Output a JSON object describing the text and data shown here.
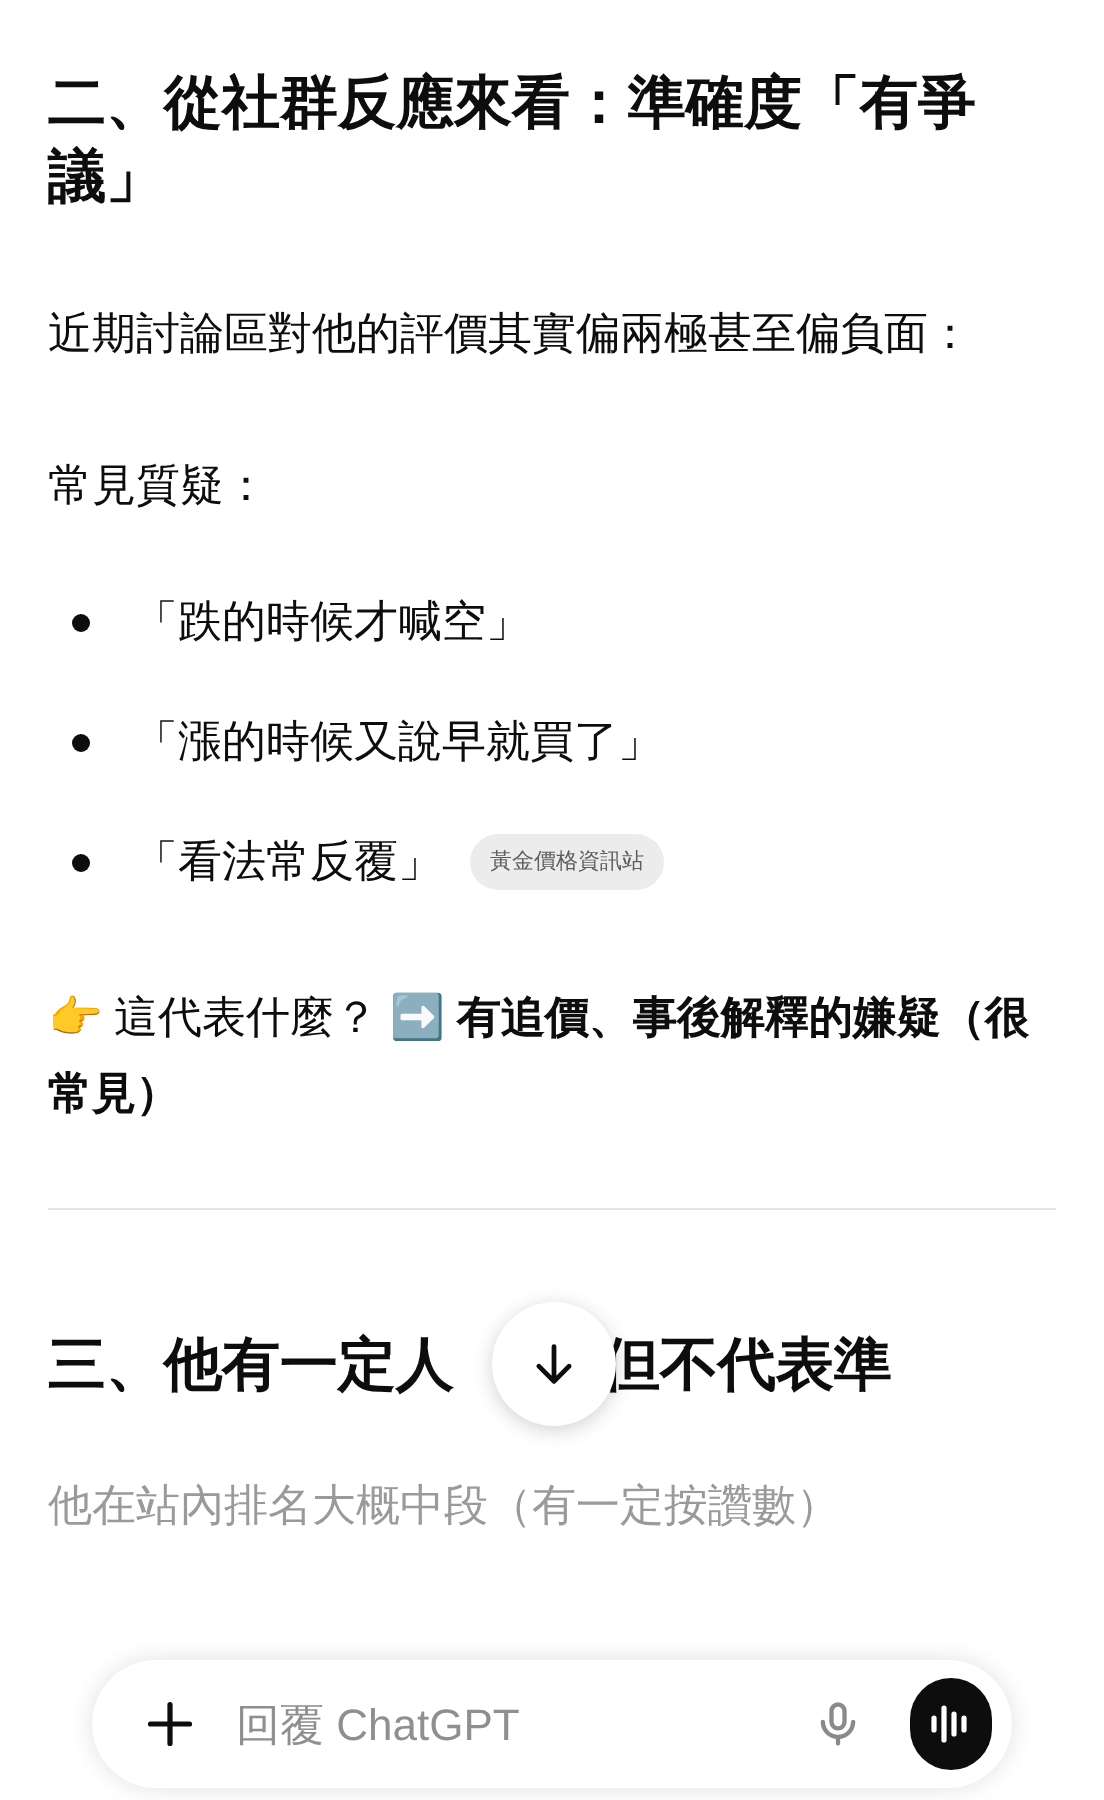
{
  "sections": [
    {
      "kind": "heading",
      "text": "二、從社群反應來看：準確度「有爭議」"
    },
    {
      "kind": "paragraph",
      "text": "近期討論區對他的評價其實偏兩極甚至偏負面："
    },
    {
      "kind": "paragraph",
      "text": "常見質疑："
    },
    {
      "kind": "bullets",
      "items": [
        {
          "text": "「跌的時候才喊空」"
        },
        {
          "text": "「漲的時候又說早就買了」"
        },
        {
          "text": "「看法常反覆」",
          "source": "黃金價格資訊站"
        }
      ]
    },
    {
      "kind": "paragraph",
      "text": "👉 這代表什麼？ ➡️ **有追價、事後解釋的嫌疑（很常見）**"
    },
    {
      "kind": "divider"
    },
    {
      "kind": "heading_partial",
      "parts": [
        "三、他有一定人",
        "但不代表準"
      ]
    },
    {
      "kind": "faded",
      "text": "他在站內排名大概中段（有一定按讚數）"
    }
  ],
  "composer": {
    "placeholder": "回覆 ChatGPT"
  }
}
